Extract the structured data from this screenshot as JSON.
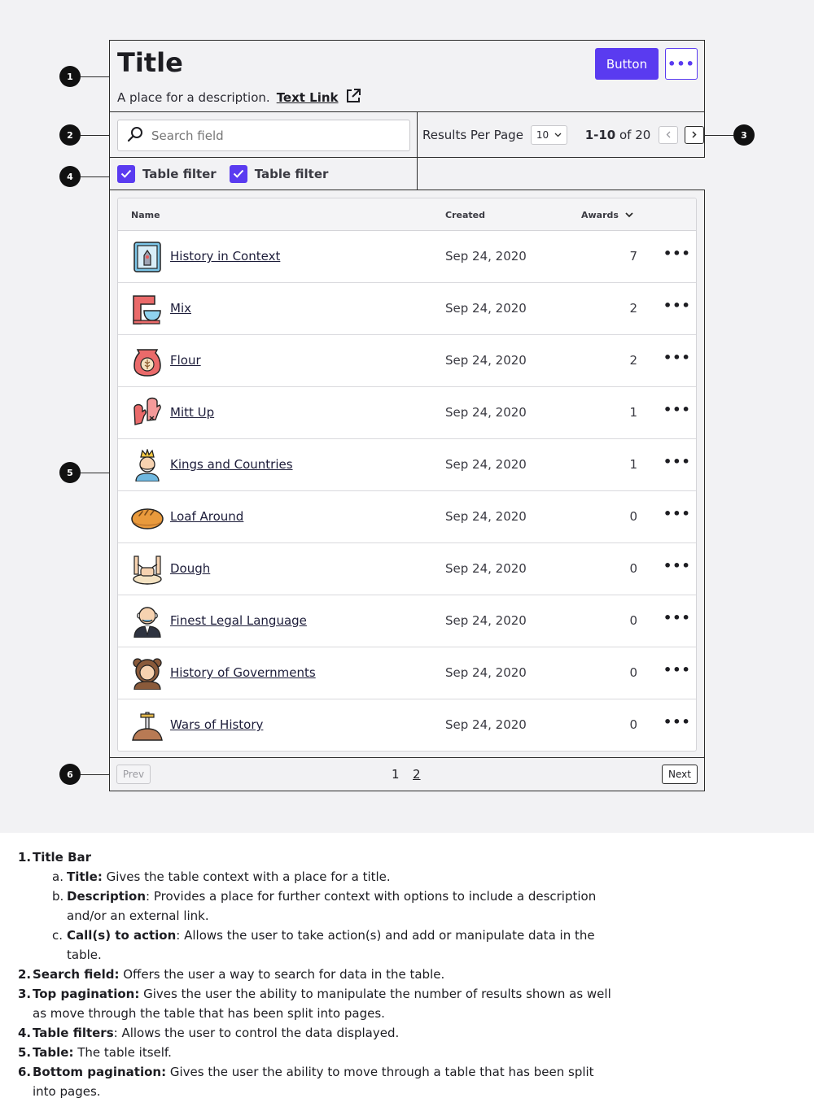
{
  "title_bar": {
    "title": "Title",
    "description": "A place for a description.",
    "link_text": "Text Link",
    "button_label": "Button",
    "more_label": "•••"
  },
  "search": {
    "placeholder": "Search field"
  },
  "top_pagination": {
    "rpp_label": "Results Per Page",
    "rpp_value": "10",
    "range_bold": "1-10",
    "range_rest": " of 20"
  },
  "filters": [
    {
      "label": "Table filter",
      "checked": true
    },
    {
      "label": "Table filter",
      "checked": true
    }
  ],
  "table": {
    "headers": {
      "name": "Name",
      "created": "Created",
      "awards": "Awards"
    },
    "rows": [
      {
        "icon": "history-book-icon",
        "name": "History in Context",
        "created": "Sep 24, 2020",
        "awards": "7"
      },
      {
        "icon": "stand-mixer-icon",
        "name": "Mix",
        "created": "Sep 24, 2020",
        "awards": "2"
      },
      {
        "icon": "flour-bag-icon",
        "name": "Flour",
        "created": "Sep 24, 2020",
        "awards": "2"
      },
      {
        "icon": "oven-mitts-icon",
        "name": "Mitt Up",
        "created": "Sep 24, 2020",
        "awards": "1"
      },
      {
        "icon": "king-icon",
        "name": "Kings and Countries",
        "created": "Sep 24, 2020",
        "awards": "1"
      },
      {
        "icon": "bread-loaf-icon",
        "name": "Loaf Around",
        "created": "Sep 24, 2020",
        "awards": "0"
      },
      {
        "icon": "dough-hands-icon",
        "name": "Dough",
        "created": "Sep 24, 2020",
        "awards": "0"
      },
      {
        "icon": "lawyer-icon",
        "name": "Finest Legal Language",
        "created": "Sep 24, 2020",
        "awards": "0"
      },
      {
        "icon": "bear-costume-icon",
        "name": "History of Governments",
        "created": "Sep 24, 2020",
        "awards": "0"
      },
      {
        "icon": "sword-in-stone-icon",
        "name": "Wars of History",
        "created": "Sep 24, 2020",
        "awards": "0"
      }
    ],
    "row_action": "•••"
  },
  "bottom_pagination": {
    "prev": "Prev",
    "next": "Next",
    "pages": [
      "1",
      "2"
    ]
  },
  "callouts": [
    "1",
    "2",
    "3",
    "4",
    "5",
    "6"
  ],
  "notes": {
    "items": [
      {
        "num": "1.",
        "title": "Title Bar",
        "text": ""
      },
      {
        "num": "2.",
        "title": "Search field:",
        "text": " Offers the user a way to search for data in the table."
      },
      {
        "num": "3.",
        "title": "Top pagination:",
        "text": " Gives the user the ability to manipulate the number of results shown as well as move through the table that has been split into pages."
      },
      {
        "num": "4.",
        "title": "Table filters",
        "text": ": Allows the user to control the data displayed."
      },
      {
        "num": "5.",
        "title": "Table:",
        "text": " The table itself."
      },
      {
        "num": "6.",
        "title": "Bottom pagination:",
        "text": " Gives the user the ability to move through a table that has been split into pages."
      }
    ],
    "sub_items": [
      {
        "num": "a.",
        "title": "Title:",
        "text": " Gives the table context with a place for a title."
      },
      {
        "num": "b.",
        "title": "Description",
        "text": ": Provides a place for further context with options to include a description and/or an external link."
      },
      {
        "num": "c.",
        "title": "Call(s) to action",
        "text": ": Allows the user to take action(s) and add or manipulate data in the table."
      }
    ]
  },
  "colors": {
    "accent": "#5a3bf0",
    "border": "#2b2b2b"
  }
}
